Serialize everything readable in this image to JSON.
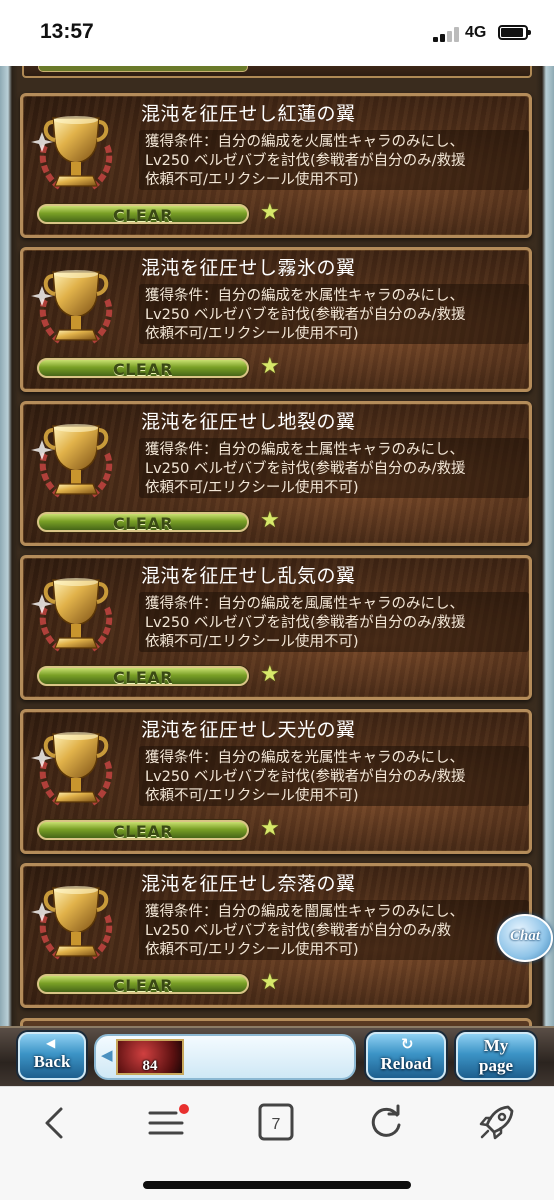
{
  "status_bar": {
    "time": "13:57",
    "network": "4G"
  },
  "achievements": [
    {
      "title": "混沌を征圧せし紅蓮の翼",
      "desc": [
        "獲得条件：自分の編成を火属性キャラのみにし、",
        "Lv250 ベルゼバブを討伐(参戦者が自分のみ/救援",
        "依頼不可/エリクシール使用不可)"
      ],
      "status": "CLEAR"
    },
    {
      "title": "混沌を征圧せし霧氷の翼",
      "desc": [
        "獲得条件：自分の編成を水属性キャラのみにし、",
        "Lv250 ベルゼバブを討伐(参戦者が自分のみ/救援",
        "依頼不可/エリクシール使用不可)"
      ],
      "status": "CLEAR"
    },
    {
      "title": "混沌を征圧せし地裂の翼",
      "desc": [
        "獲得条件：自分の編成を土属性キャラのみにし、",
        "Lv250 ベルゼバブを討伐(参戦者が自分のみ/救援",
        "依頼不可/エリクシール使用不可)"
      ],
      "status": "CLEAR"
    },
    {
      "title": "混沌を征圧せし乱気の翼",
      "desc": [
        "獲得条件：自分の編成を風属性キャラのみにし、",
        "Lv250 ベルゼバブを討伐(参戦者が自分のみ/救援",
        "依頼不可/エリクシール使用不可)"
      ],
      "status": "CLEAR"
    },
    {
      "title": "混沌を征圧せし天光の翼",
      "desc": [
        "獲得条件：自分の編成を光属性キャラのみにし、",
        "Lv250 ベルゼバブを討伐(参戦者が自分のみ/救援",
        "依頼不可/エリクシール使用不可)"
      ],
      "status": "CLEAR"
    },
    {
      "title": "混沌を征圧せし奈落の翼",
      "desc": [
        "獲得条件：自分の編成を闇属性キャラのみにし、",
        "Lv250 ベルゼバブを討伐(参戦者が自分のみ/救",
        "依頼不可/エリクシール使用不可)"
      ],
      "status": "CLEAR"
    }
  ],
  "chat_button": {
    "label": "Chat"
  },
  "game_nav": {
    "back_label": "Back",
    "reload_label": "Reload",
    "mypage_line1": "My",
    "mypage_line2": "page",
    "thumb_count": "84"
  },
  "browser_toolbar": {
    "tab_count": "7"
  }
}
